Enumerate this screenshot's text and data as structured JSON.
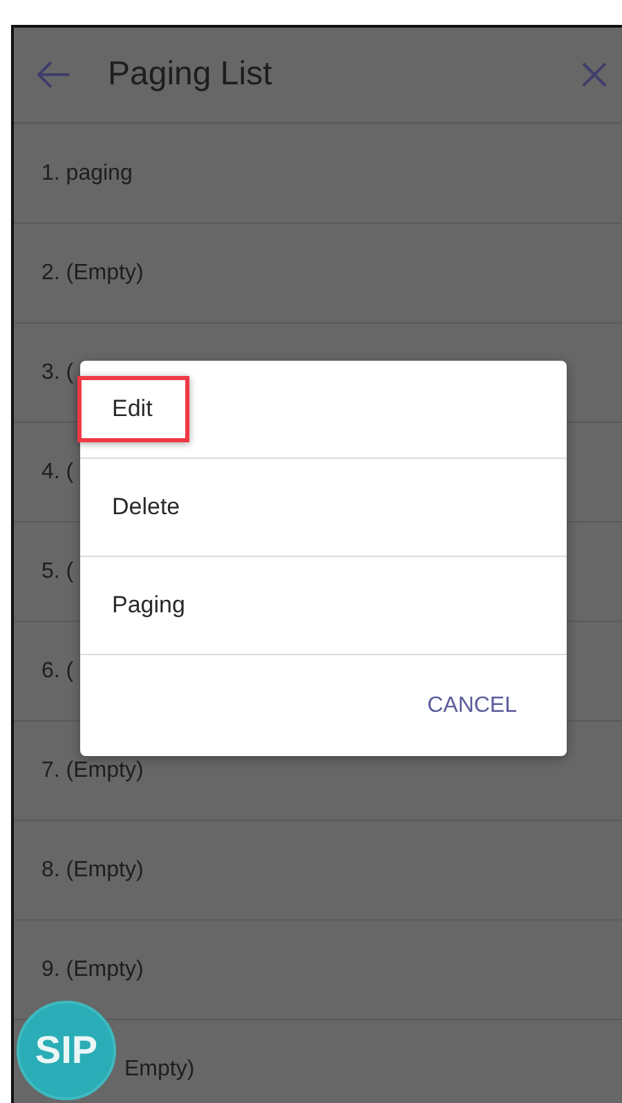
{
  "header": {
    "title": "Paging List"
  },
  "list": [
    {
      "label": "1. paging"
    },
    {
      "label": "2. (Empty)"
    },
    {
      "label": "3. ("
    },
    {
      "label": "4. ("
    },
    {
      "label": "5. ("
    },
    {
      "label": "6. ("
    },
    {
      "label": "7. (Empty)"
    },
    {
      "label": "8. (Empty)"
    },
    {
      "label": "9. (Empty)"
    },
    {
      "label": "Empty)"
    }
  ],
  "dialog": {
    "items": [
      {
        "label": "Edit",
        "highlighted": true
      },
      {
        "label": "Delete",
        "highlighted": false
      },
      {
        "label": "Paging",
        "highlighted": false
      }
    ],
    "cancel": "CANCEL"
  },
  "sip_badge": "SIP"
}
